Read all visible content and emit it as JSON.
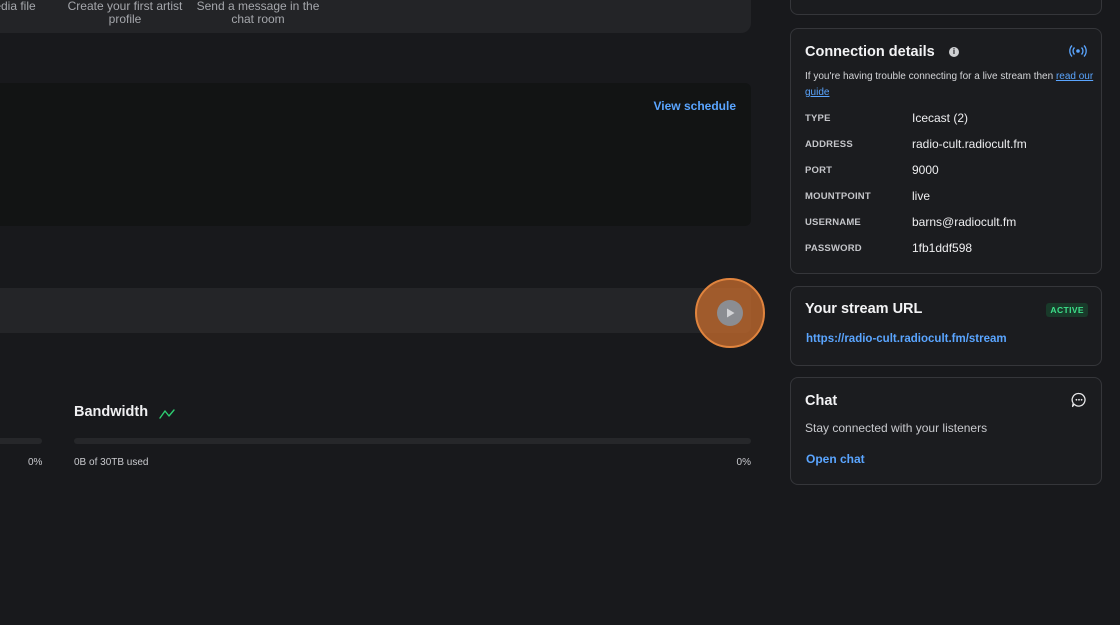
{
  "quick_actions": [
    {
      "label": "edia file"
    },
    {
      "label": "Create your first artist profile"
    },
    {
      "label": "Send a message in the chat room"
    }
  ],
  "schedule": {
    "view_label": "View schedule"
  },
  "usage": {
    "left_percent": "0%",
    "bandwidth": {
      "title": "Bandwidth",
      "used_label": "0B of 30TB used",
      "percent": "0%",
      "fill_fraction": 0
    }
  },
  "connection": {
    "title": "Connection details",
    "help_text": "If you're having trouble connecting for a live stream then",
    "help_link": "read our guide",
    "rows": [
      {
        "key": "TYPE",
        "value": "Icecast (2)"
      },
      {
        "key": "ADDRESS",
        "value": "radio-cult.radiocult.fm"
      },
      {
        "key": "PORT",
        "value": "9000"
      },
      {
        "key": "MOUNTPOINT",
        "value": "live"
      },
      {
        "key": "USERNAME",
        "value": "barns@radiocult.fm"
      },
      {
        "key": "PASSWORD",
        "value": "1fb1ddf598"
      }
    ]
  },
  "stream": {
    "title": "Your stream URL",
    "badge": "ACTIVE",
    "url": "https://radio-cult.radiocult.fm/stream"
  },
  "chat": {
    "title": "Chat",
    "subtitle": "Stay connected with your listeners",
    "open_label": "Open chat"
  },
  "icons": {
    "info": "info-icon",
    "broadcast": "broadcast-icon",
    "play": "play-icon",
    "trend": "trend-icon",
    "chat": "chat-bubble-icon"
  },
  "colors": {
    "accent": "#5aa5ff",
    "success": "#3de08a",
    "highlight": "#e0843e"
  }
}
